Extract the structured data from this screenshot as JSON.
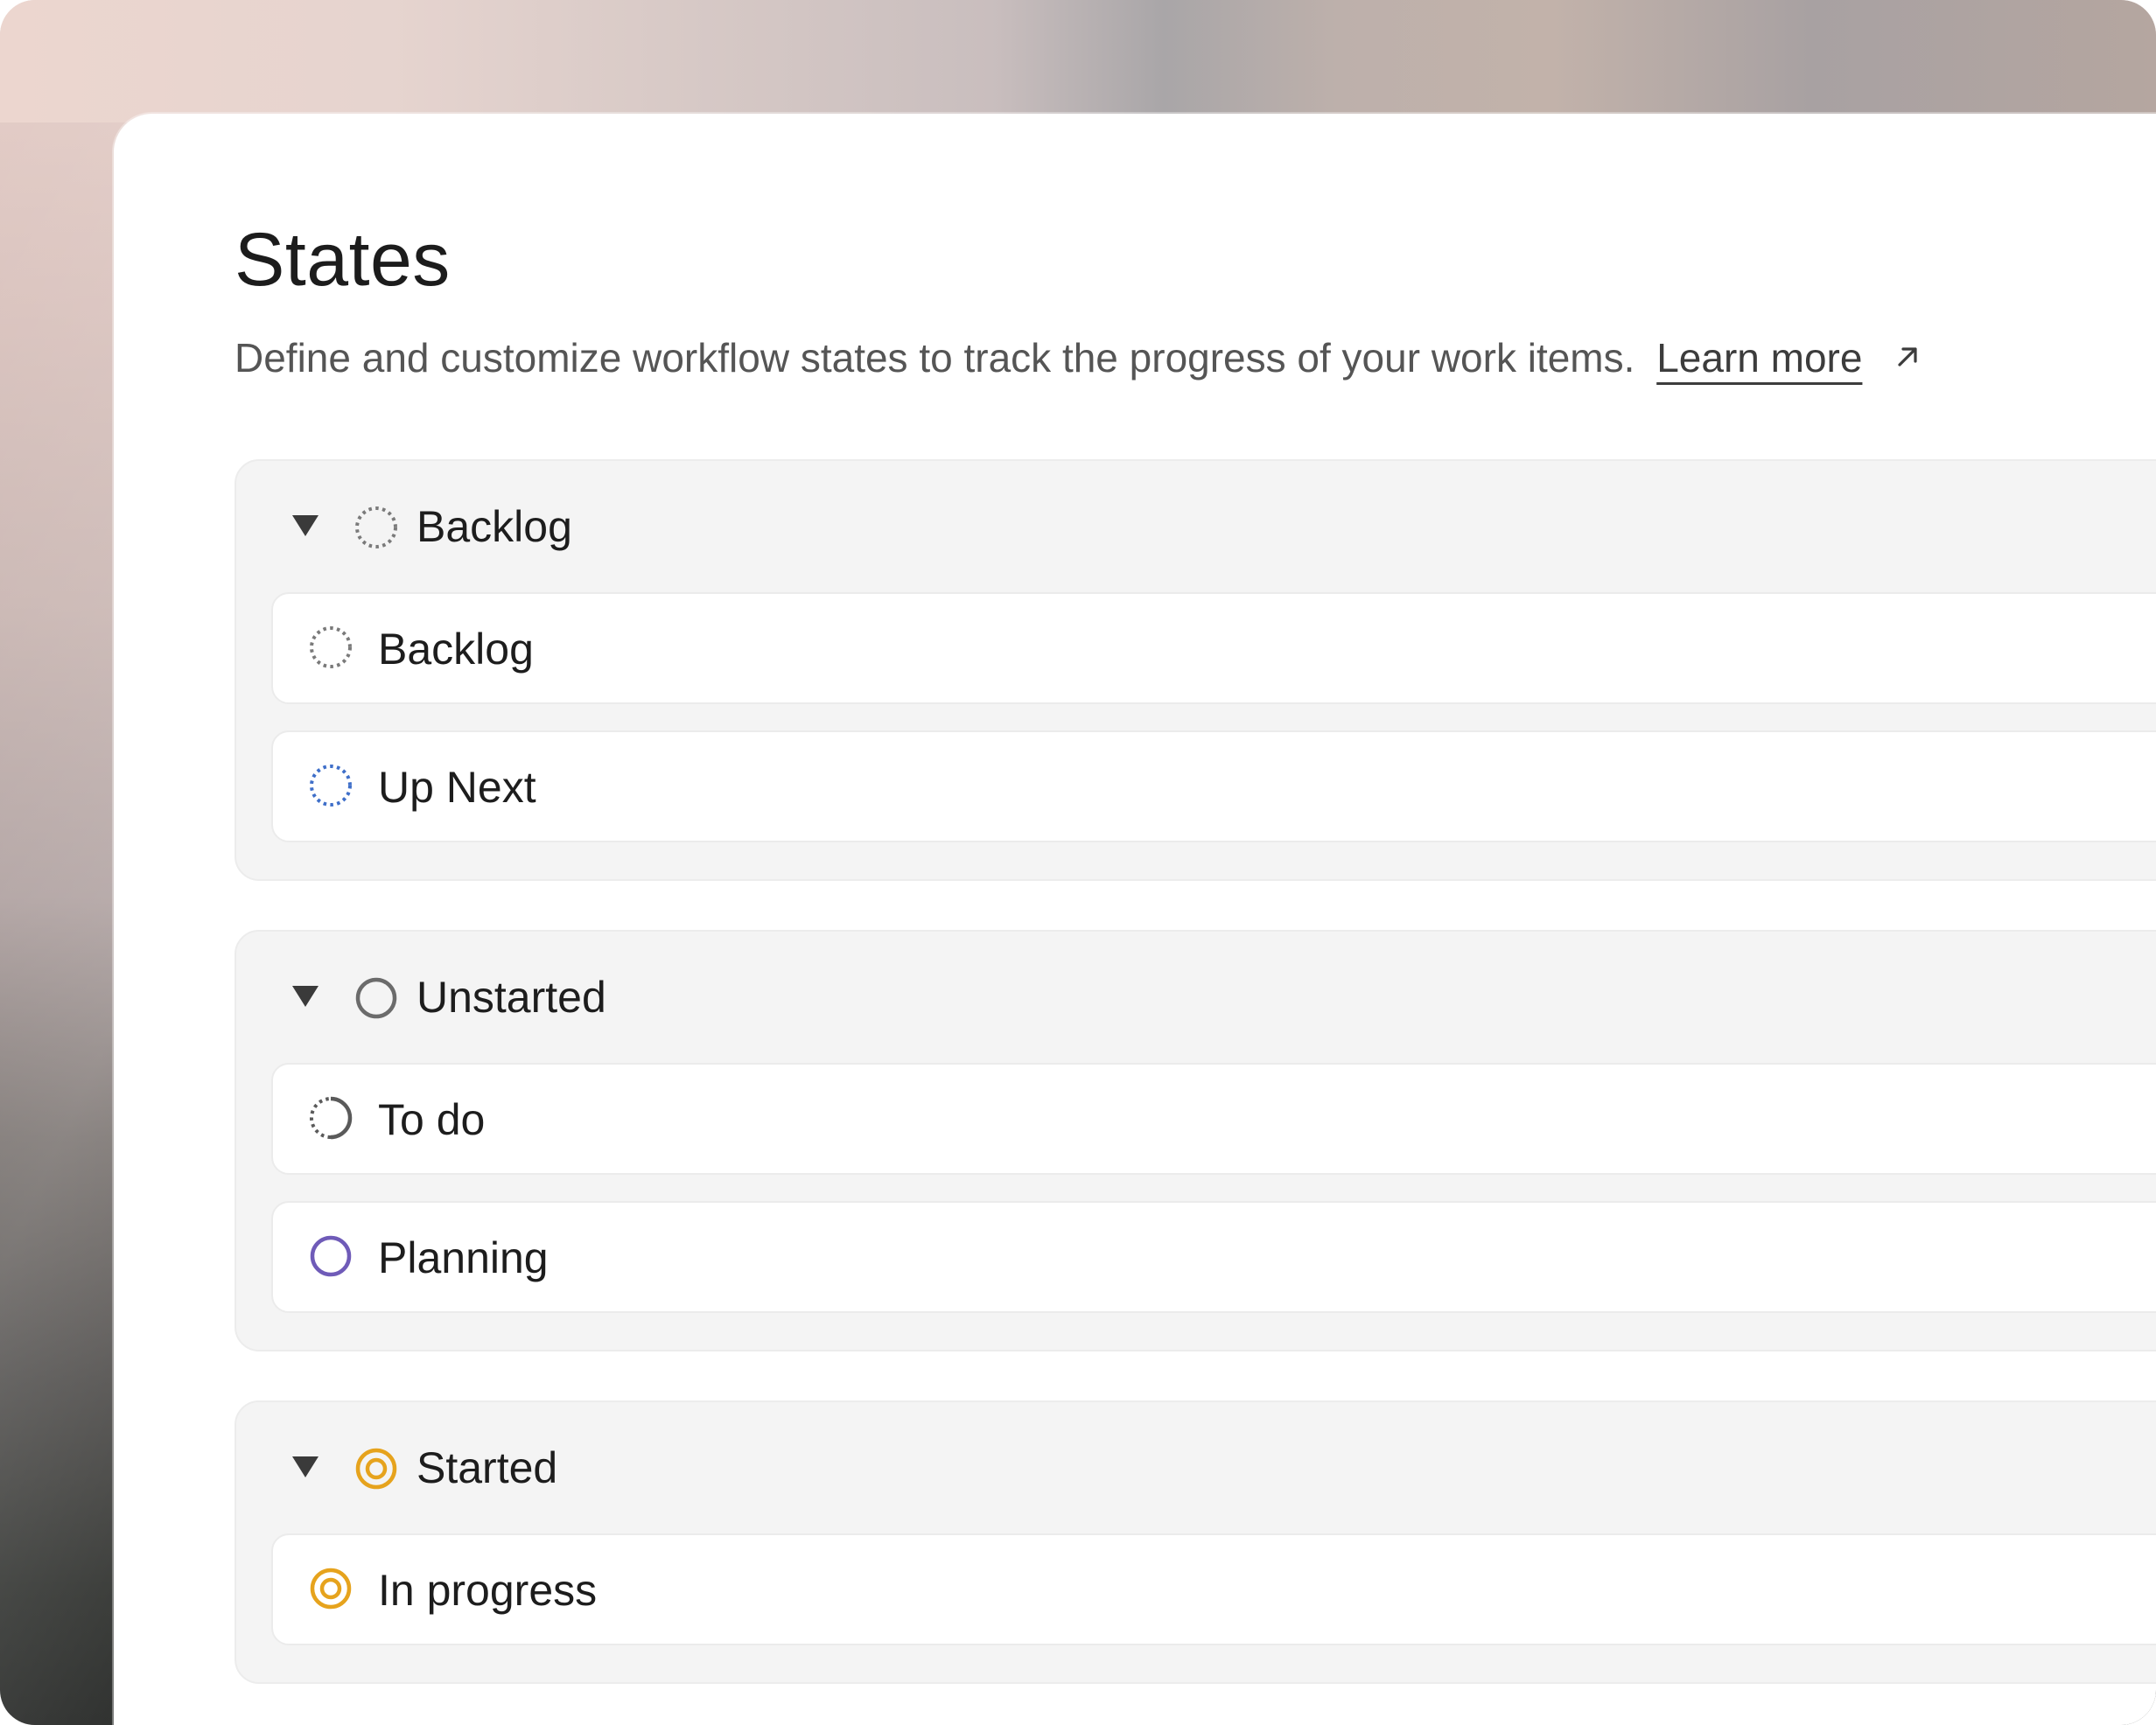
{
  "page": {
    "title": "States",
    "description": "Define and customize workflow states to track the progress of your work items.",
    "learn_more": "Learn more",
    "learn_more_icon": "external-link-arrow-icon"
  },
  "groups": [
    {
      "label": "Backlog",
      "icon": "backlog-dashed-circle-icon",
      "color": "#7a7a7a",
      "expanded": true,
      "states": [
        {
          "label": "Backlog",
          "icon": "backlog-dashed-circle-icon",
          "color": "#7a7a7a"
        },
        {
          "label": "Up Next",
          "icon": "backlog-dashed-circle-icon",
          "color": "#3f6fc9"
        }
      ]
    },
    {
      "label": "Unstarted",
      "icon": "unstarted-circle-icon",
      "color": "#6b6b6b",
      "expanded": true,
      "states": [
        {
          "label": "To do",
          "icon": "todo-half-dashed-circle-icon",
          "color": "#5a5a5a"
        },
        {
          "label": "Planning",
          "icon": "unstarted-circle-icon",
          "color": "#6f5bb8"
        }
      ]
    },
    {
      "label": "Started",
      "icon": "started-target-circle-icon",
      "color": "#e6a31d",
      "expanded": true,
      "states": [
        {
          "label": "In progress",
          "icon": "started-target-circle-icon",
          "color": "#e6a31d"
        }
      ]
    }
  ]
}
